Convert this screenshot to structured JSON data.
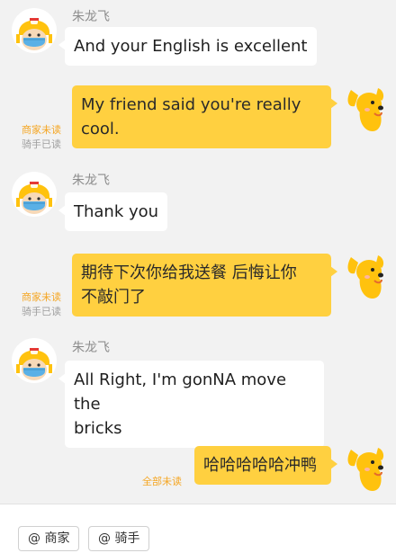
{
  "messages": [
    {
      "side": "in",
      "sender": "朱龙飞",
      "text": "And your English is excellent"
    },
    {
      "side": "out",
      "lines": [
        "My friend said you're really",
        "cool."
      ],
      "status_unread": "商家未读",
      "status_read": "骑手已读"
    },
    {
      "side": "in",
      "sender": "朱龙飞",
      "text": "Thank you"
    },
    {
      "side": "out",
      "lines": [
        "期待下次你给我送餐 后悔让你",
        "不敲门了"
      ],
      "status_unread": "商家未读",
      "status_read": "骑手已读"
    },
    {
      "side": "in",
      "sender": "朱龙飞",
      "lines": [
        "All Right, I'm gonNA move the",
        "bricks"
      ]
    },
    {
      "side": "out",
      "text": "哈哈哈哈哈冲鸭",
      "status_unread": "全部未读"
    }
  ],
  "bottom_bar": {
    "mentions": [
      {
        "label": "@ 商家"
      },
      {
        "label": "@ 骑手"
      }
    ]
  },
  "colors": {
    "outgoing_bubble": "#ffd040",
    "incoming_bubble": "#ffffff",
    "unread_status": "#f5a623",
    "read_status": "#a0a0a0",
    "background": "#f2f2f2"
  },
  "icons": {
    "rider_avatar": "rider-avatar-icon",
    "dog_avatar": "dog-avatar-icon"
  }
}
